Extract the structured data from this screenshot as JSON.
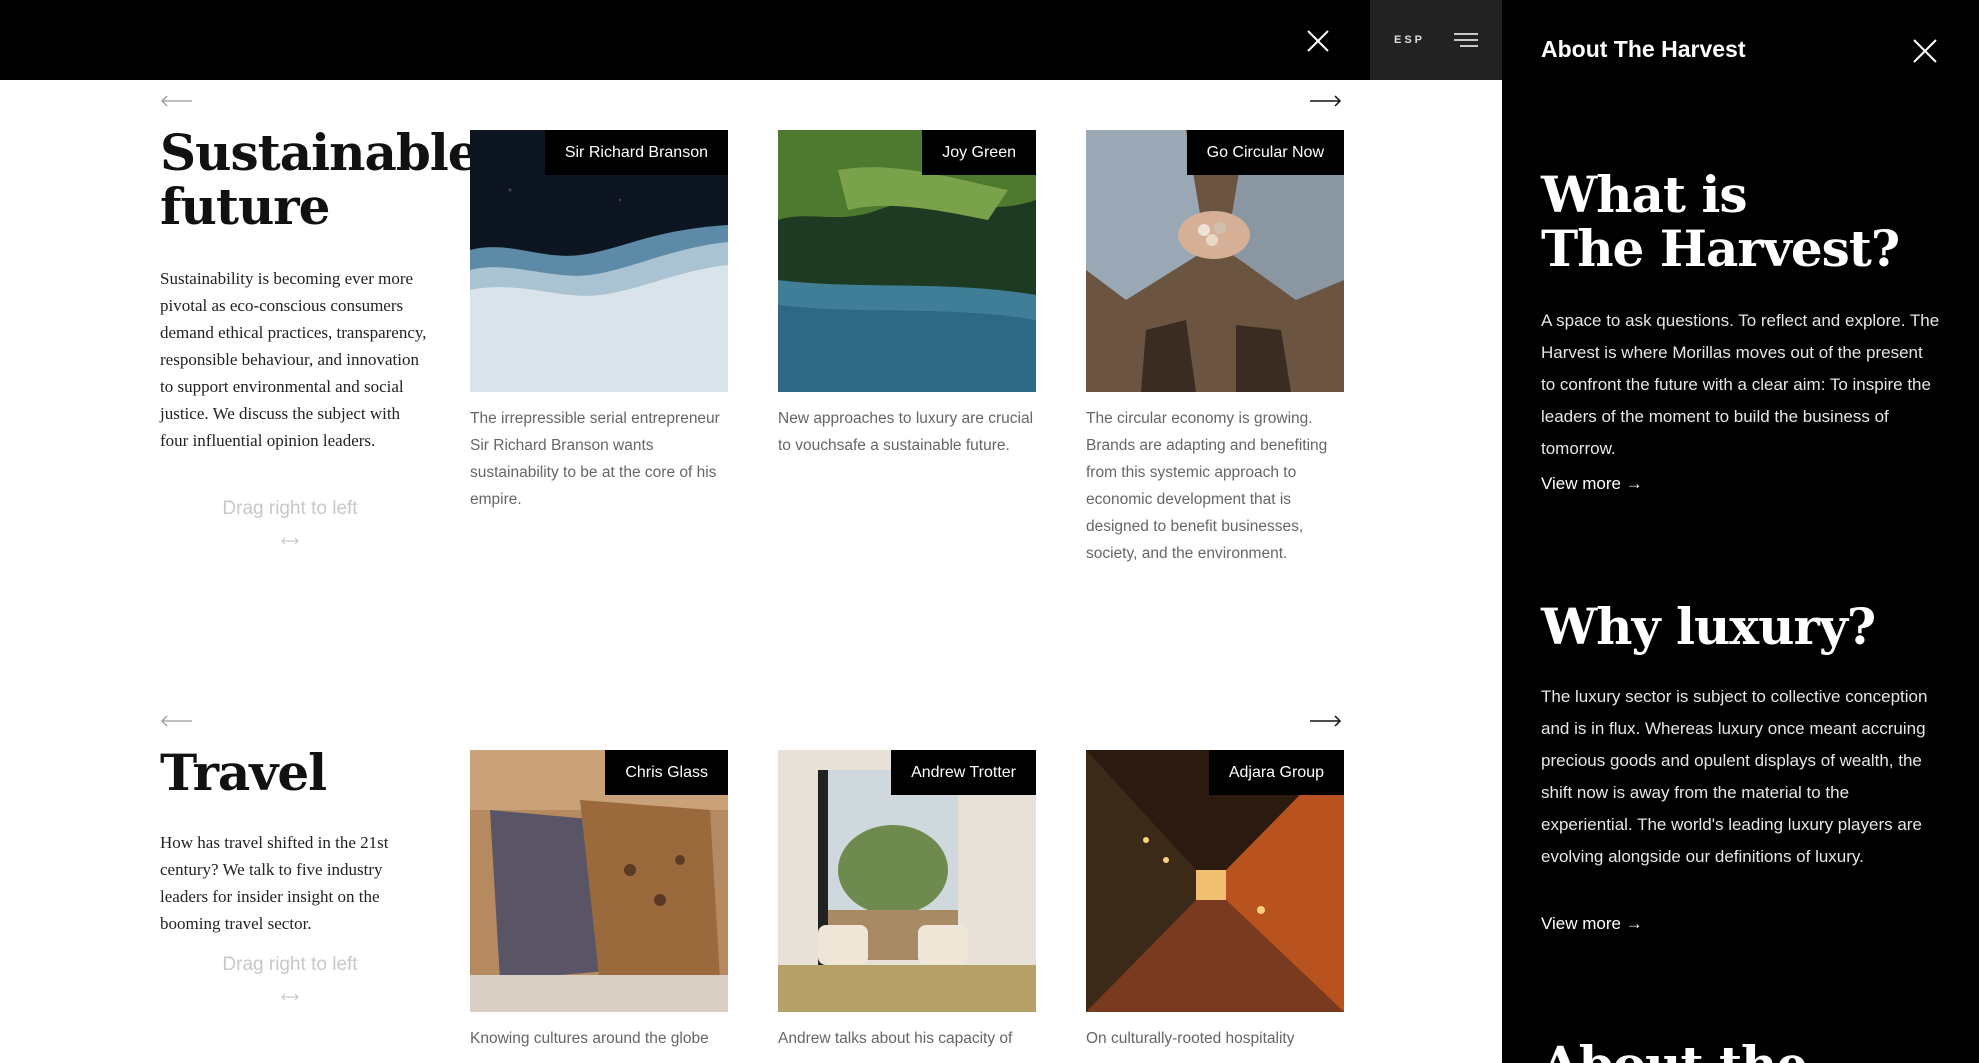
{
  "topbar": {
    "lang": "ESP"
  },
  "sections": [
    {
      "title_lines": [
        "Sustainable",
        "future"
      ],
      "description": "Sustainability is becoming ever more pivotal as eco-conscious consumers demand ethical practices, transparency, responsible behaviour, and innovation to support environmental and social justice. We discuss the subject with four influential opinion leaders.",
      "drag_label": "Drag right to left",
      "cards": [
        {
          "name": "Sir Richard Branson",
          "text": "The irrepressible serial entrepreneur Sir Richard Branson wants sustainability to be at the core of his empire."
        },
        {
          "name": "Joy Green",
          "text": "New approaches to luxury are crucial to vouchsafe a sustainable future."
        },
        {
          "name": "Go Circular Now",
          "text": "The circular economy is growing. Brands are adapting and benefiting from this systemic approach to economic development that is designed to benefit businesses, society, and the environment."
        }
      ]
    },
    {
      "title_lines": [
        "Travel"
      ],
      "description": "How has travel shifted in the 21st century? We talk to five industry leaders for insider insight on the booming travel sector.",
      "drag_label": "Drag right to left",
      "cards": [
        {
          "name": "Chris Glass",
          "text": "Knowing cultures around the globe"
        },
        {
          "name": "Andrew Trotter",
          "text": "Andrew talks about his capacity of"
        },
        {
          "name": "Adjara Group",
          "text": "On culturally-rooted hospitality"
        }
      ]
    }
  ],
  "panel": {
    "title": "About The Harvest",
    "blocks": [
      {
        "heading_lines": [
          "What is",
          "The Harvest?"
        ],
        "text": "A space to ask questions. To reflect and explore. The Harvest is where Morillas moves out of the present to confront the future with a clear aim: To inspire the leaders of the moment to build the business of tomorrow.",
        "link": "View more →"
      },
      {
        "heading_lines": [
          "Why luxury?"
        ],
        "text": "The luxury sector is subject to collective conception and is in flux. Whereas luxury once meant accruing precious goods and opulent displays of wealth, the shift now is away from the material to the experiential. The world's leading luxury players are evolving alongside our definitions of luxury.",
        "link": "View more →"
      },
      {
        "heading_lines": [
          "About the"
        ]
      }
    ]
  }
}
